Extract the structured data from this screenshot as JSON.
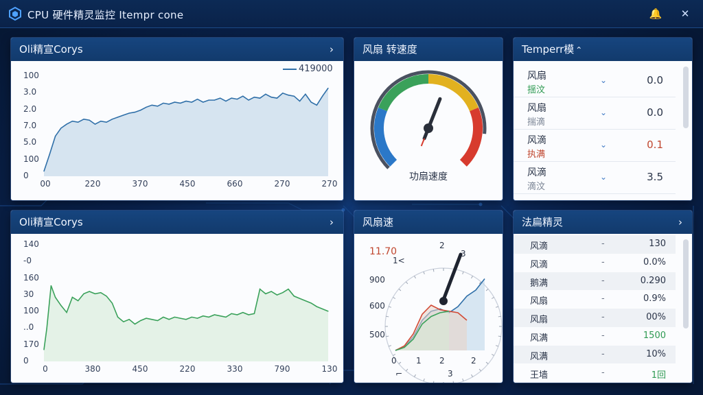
{
  "window": {
    "title": "CPU 硬件精灵监控 Itempr cone",
    "icon": "cpu-hexagon-icon",
    "notify_icon": "bell-icon",
    "close_icon": "close-icon",
    "notify_glyph": "🔔",
    "close_glyph": "✕"
  },
  "panels": {
    "cores_chart": {
      "title": "Oli精宣Corys",
      "chevron": "›",
      "legend": "419000",
      "chart_data": {
        "type": "area",
        "series_color": "#2f6fa8",
        "fill_color": "#c9dceb",
        "ytick_labels": [
          "100",
          "3.0",
          "2.0",
          "7.0",
          "5.0",
          "100",
          "0"
        ],
        "xtick_labels": [
          "00",
          "220",
          "370",
          "450",
          "660",
          "270",
          "270"
        ],
        "series": [
          {
            "name": "419000",
            "x": [
              0,
              0.02,
              0.04,
              0.06,
              0.08,
              0.1,
              0.12,
              0.14,
              0.16,
              0.18,
              0.2,
              0.22,
              0.24,
              0.26,
              0.28,
              0.3,
              0.32,
              0.34,
              0.36,
              0.38,
              0.4,
              0.42,
              0.44,
              0.46,
              0.48,
              0.5,
              0.52,
              0.54,
              0.56,
              0.58,
              0.6,
              0.62,
              0.64,
              0.66,
              0.68,
              0.7,
              0.72,
              0.74,
              0.76,
              0.78,
              0.8,
              0.82,
              0.84,
              0.86,
              0.88,
              0.9,
              0.92,
              0.94,
              0.96,
              0.98,
              1.0
            ],
            "y": [
              5,
              22,
              40,
              48,
              52,
              55,
              54,
              57,
              56,
              52,
              55,
              54,
              57,
              59,
              61,
              63,
              64,
              66,
              69,
              71,
              70,
              73,
              72,
              74,
              73,
              75,
              74,
              77,
              74,
              76,
              76,
              78,
              75,
              78,
              77,
              80,
              76,
              79,
              78,
              82,
              79,
              78,
              83,
              81,
              80,
              75,
              82,
              74,
              71,
              80,
              88
            ]
          }
        ]
      }
    },
    "fan_gauge": {
      "title": "风扇 转速度",
      "caption": "功扇速度",
      "value_fraction": 0.58,
      "colors": {
        "blue": "#2b78c8",
        "green": "#3aa15a",
        "yellow": "#e2b11f",
        "red": "#d73b2e"
      }
    },
    "temp_list": {
      "title": "Temperr模",
      "chevron": "⌃",
      "rows": [
        {
          "name": "风扇",
          "sub": "揺汶",
          "sub_color": "#2e9a52",
          "chevron": "⌄",
          "value": "0.0",
          "value_color": "#2a3448"
        },
        {
          "name": "风扇",
          "sub": "揣滴",
          "sub_color": "#7a8494",
          "chevron": "⌄",
          "value": "0.0",
          "value_color": "#2a3448"
        },
        {
          "name": "风滴",
          "sub": "执满",
          "sub_color": "#c0462e",
          "chevron": "⌄",
          "value": "0.1",
          "value_color": "#c0462e"
        },
        {
          "name": "风滴",
          "sub": "滴汶",
          "sub_color": "#7a8494",
          "chevron": "⌄",
          "value": "3.5",
          "value_color": "#2a3448"
        }
      ]
    },
    "cores_chart2": {
      "title": "Oli精宣Corys",
      "chevron": "›",
      "chart_data": {
        "type": "area",
        "series_color": "#3aa15a",
        "fill_color": "#dcefdf",
        "ytick_labels": [
          "140",
          "-0",
          "160",
          "30",
          "100",
          "..0",
          "170",
          "0"
        ],
        "xtick_labels": [
          "0",
          "380",
          "450",
          "220",
          "330",
          "790",
          "130"
        ],
        "series": [
          {
            "x": [
              0,
              0.01,
              0.025,
              0.04,
              0.06,
              0.08,
              0.1,
              0.12,
              0.14,
              0.16,
              0.18,
              0.2,
              0.22,
              0.24,
              0.26,
              0.28,
              0.3,
              0.32,
              0.34,
              0.36,
              0.38,
              0.4,
              0.42,
              0.44,
              0.46,
              0.48,
              0.5,
              0.52,
              0.54,
              0.56,
              0.58,
              0.6,
              0.62,
              0.64,
              0.66,
              0.68,
              0.7,
              0.72,
              0.74,
              0.76,
              0.78,
              0.8,
              0.82,
              0.84,
              0.86,
              0.88,
              0.9,
              0.92,
              0.94,
              0.96,
              0.98,
              1.0
            ],
            "y": [
              10,
              28,
              65,
              55,
              48,
              42,
              55,
              52,
              58,
              60,
              58,
              59,
              56,
              50,
              38,
              34,
              36,
              32,
              35,
              37,
              36,
              35,
              38,
              36,
              38,
              37,
              36,
              38,
              37,
              39,
              38,
              40,
              39,
              38,
              41,
              40,
              42,
              40,
              41,
              62,
              58,
              60,
              57,
              59,
              62,
              56,
              54,
              52,
              50,
              47,
              45,
              43
            ]
          }
        ]
      }
    },
    "fan_speed": {
      "title": "风扇速",
      "readout": "11.70",
      "outer_labels": [
        "2",
        "3",
        "1<"
      ],
      "y_labels": [
        "900",
        "600",
        "500"
      ],
      "x_labels": [
        "0",
        "1",
        "2",
        "2"
      ],
      "foot_labels": [
        "⌐",
        "3"
      ],
      "chart_data": {
        "type": "area",
        "series": [
          {
            "color": "#2f6fa8",
            "x": [
              0,
              0.1,
              0.2,
              0.3,
              0.4,
              0.5,
              0.6,
              0.7,
              0.8,
              0.9,
              1.0
            ],
            "y": [
              0,
              5,
              18,
              40,
              52,
              55,
              50,
              58,
              72,
              80,
              95
            ]
          },
          {
            "color": "#d24a36",
            "x": [
              0,
              0.1,
              0.2,
              0.3,
              0.4,
              0.5,
              0.6,
              0.7,
              0.8
            ],
            "y": [
              0,
              6,
              22,
              48,
              60,
              54,
              52,
              50,
              40
            ]
          },
          {
            "color": "#3aa15a",
            "x": [
              0,
              0.1,
              0.2,
              0.3,
              0.4,
              0.5,
              0.6
            ],
            "y": [
              0,
              4,
              15,
              35,
              45,
              50,
              52
            ]
          }
        ]
      }
    },
    "fan_table": {
      "title": "法扁精灵",
      "chevron": "›",
      "rows": [
        {
          "name": "风滴",
          "dash": "-",
          "value": "130",
          "value_color": "#2a3448"
        },
        {
          "name": "风滴",
          "dash": "-",
          "value": "0.0%",
          "value_color": "#2a3448"
        },
        {
          "name": "鹅满",
          "dash": "-",
          "value": "0.290",
          "value_color": "#2a3448"
        },
        {
          "name": "风扇",
          "dash": "-",
          "value": "0.9%",
          "value_color": "#2a3448"
        },
        {
          "name": "风扇",
          "dash": "-",
          "value": "00%",
          "value_color": "#2a3448"
        },
        {
          "name": "风满",
          "dash": "-",
          "value": "1500",
          "value_color": "#2e9a52"
        },
        {
          "name": "风满",
          "dash": "-",
          "value": "10%",
          "value_color": "#2a3448"
        },
        {
          "name": "王墙",
          "dash": "-",
          "value": "1回",
          "value_color": "#2e9a52"
        }
      ]
    }
  }
}
